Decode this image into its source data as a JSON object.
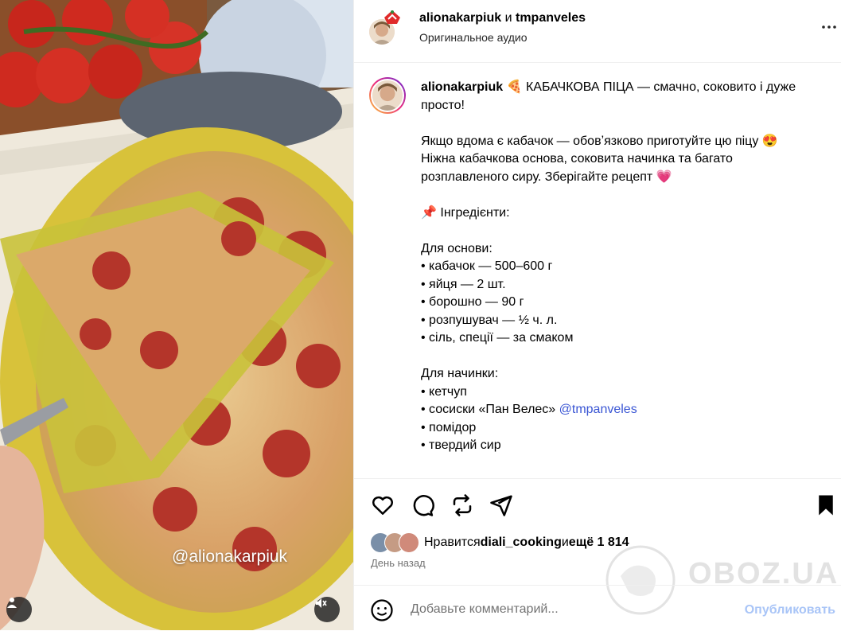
{
  "media": {
    "watermark": "@alionakarpiuk",
    "icons": [
      "user-tag-icon",
      "mute-icon"
    ]
  },
  "header": {
    "user1": "alionakarpiuk",
    "joiner": " и ",
    "user2": "tmpanveles",
    "audio": "Оригинальное аудио"
  },
  "caption": {
    "username": "alionakarpiuk",
    "line1": " 🍕 КАБАЧКОВА ПІЦА — смачно, соковито і дуже просто!",
    "para2": "Якщо вдома є кабачок — обовʼязково приготуйте цю піцу 😍\nНіжна кабачкова основа, соковита начинка та багато розплавленого сиру. Зберігайте рецепт 💗",
    "ingredients_title": "📌 Інгредієнти:",
    "base_title": "Для основи:",
    "base_items": [
      "• кабачок — 500–600 г",
      "• яйця — 2 шт.",
      "• борошно — 90 г",
      "• розпушувач — ½ ч. л.",
      "• сіль, спеції — за смаком"
    ],
    "filling_title": "Для начинки:",
    "filling_1": "• кетчуп",
    "filling_2_prefix": "• сосиски «Пан Велес» ",
    "filling_2_mention": "@tmpanveles",
    "filling_3": "• помідор",
    "filling_4": "• твердий сир"
  },
  "likes": {
    "prefix": "Нравится ",
    "user": "diali_cooking",
    "middle": " и ",
    "rest": "ещё 1 814"
  },
  "time": "День назад",
  "comment": {
    "placeholder": "Добавьте комментарий...",
    "publish": "Опубликовать"
  },
  "site_watermark": "OBOZ.UA",
  "colors": {
    "link": "#3a56d4",
    "publish": "#a9c5f7",
    "muted": "#737373",
    "heart": "#e8446b"
  }
}
